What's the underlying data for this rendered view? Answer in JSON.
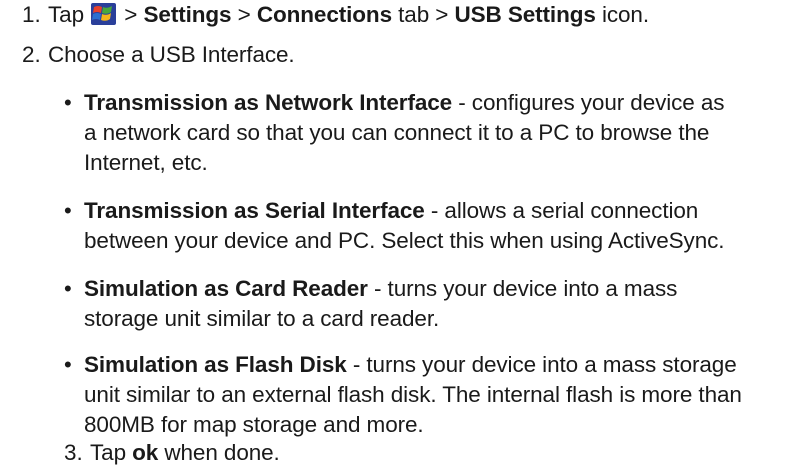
{
  "steps": {
    "s1": {
      "num": "1.",
      "tap": "Tap",
      "sep1": ">",
      "settings": "Settings",
      "sep2": ">",
      "connections": "Connections",
      "tab_sep": "tab >",
      "usb_settings": "USB Settings",
      "icon_word": "icon.",
      "start_icon": "windows-start-icon"
    },
    "s2": {
      "num": "2.",
      "text": "Choose a USB Interface."
    },
    "s3": {
      "num": "3.",
      "tap": "Tap",
      "ok": "ok",
      "rest": "when done."
    }
  },
  "bullets": [
    {
      "title": "Transmission as Network Interface",
      "desc_l1": "- configures your device as",
      "desc_l2": "a network card so that you can connect it to a PC to browse the",
      "desc_l3": "Internet, etc."
    },
    {
      "title": "Transmission as Serial Interface",
      "desc_l1": "- allows a serial connection",
      "desc_l2": "between your device and PC. Select this when using ActiveSync."
    },
    {
      "title": "Simulation as Card Reader",
      "desc_l1": "- turns your device into a mass",
      "desc_l2": "storage unit similar to a card reader."
    },
    {
      "title": "Simulation as Flash Disk",
      "desc_l1": "- turns your device into a mass storage",
      "desc_l2": "unit similar to an external flash disk. The internal flash is more than",
      "desc_l3": "800MB for map storage and more."
    }
  ],
  "bullet_glyph": "•",
  "colors": {
    "text": "#1a1a1a",
    "logo_red": "#e8412c",
    "logo_green": "#47a83c",
    "logo_blue": "#2c6fd0",
    "logo_yellow": "#f4b51a"
  }
}
